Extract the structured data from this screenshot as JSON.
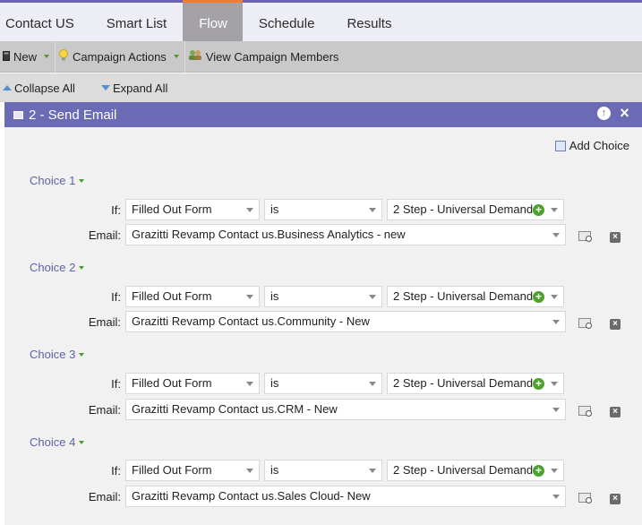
{
  "tabs": [
    {
      "label": "Contact US",
      "active": false
    },
    {
      "label": "Smart List",
      "active": false
    },
    {
      "label": "Flow",
      "active": true
    },
    {
      "label": "Schedule",
      "active": false
    },
    {
      "label": "Results",
      "active": false
    }
  ],
  "toolbar": {
    "new_label": "New",
    "campaign_actions_label": "Campaign Actions",
    "view_members_label": "View Campaign Members"
  },
  "subbar": {
    "collapse_label": "Collapse All",
    "expand_label": "Expand All"
  },
  "panel": {
    "title": "2 - Send Email",
    "add_choice_label": "Add Choice",
    "if_label": "If:",
    "email_label": "Email:",
    "choices": [
      {
        "label": "Choice 1",
        "field": "Filled Out Form",
        "operator": "is",
        "value": "2 Step - Universal Demand",
        "email": "Grazitti Revamp Contact us.Business Analytics - new"
      },
      {
        "label": "Choice 2",
        "field": "Filled Out Form",
        "operator": "is",
        "value": "2 Step - Universal Demand",
        "email": "Grazitti Revamp Contact us.Community - New"
      },
      {
        "label": "Choice 3",
        "field": "Filled Out Form",
        "operator": "is",
        "value": "2 Step - Universal Demand",
        "email": "Grazitti Revamp Contact us.CRM - New"
      },
      {
        "label": "Choice 4",
        "field": "Filled Out Form",
        "operator": "is",
        "value": "2 Step - Universal Demand",
        "email": "Grazitti Revamp Contact us.Sales Cloud- New"
      }
    ]
  },
  "colors": {
    "panel_header": "#6b6ab5",
    "active_tab": "#a4a2a6",
    "active_tab_accent": "#f27c2a",
    "choice_label": "#5f62a8",
    "add_icon": "#4da12d"
  }
}
